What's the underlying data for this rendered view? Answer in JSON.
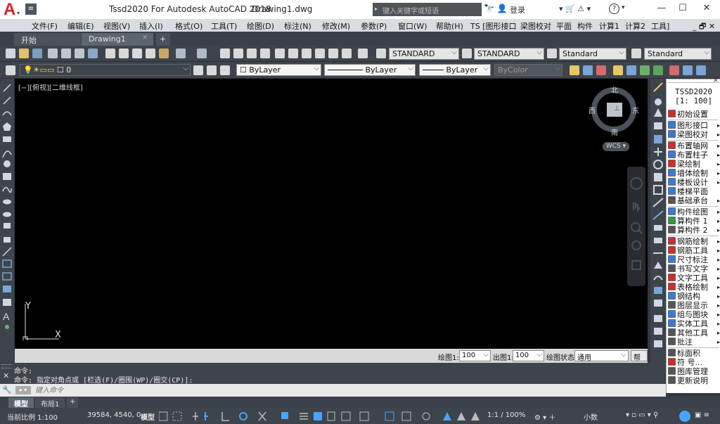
{
  "title_bar": {
    "app_title": "Tssd2020 For Autodesk AutoCAD 2018",
    "doc_title": "Drawing1.dwg",
    "search_placeholder": "键入关键字或短语",
    "login_label": "登录",
    "minimize": "—",
    "maximize": "☐",
    "close": "✕"
  },
  "menus": [
    "文件(F)",
    "编辑(E)",
    "视图(V)",
    "插入(I)",
    "格式(O)",
    "工具(T)",
    "绘图(D)",
    "标注(N)",
    "修改(M)",
    "参数(P)",
    "窗口(W)",
    "帮助(H)",
    "TS [图形接口",
    "梁图校对",
    "平面",
    "构件",
    "计算1",
    "计算2",
    "工具]"
  ],
  "menubar_controls": "_ 🗗 ✕",
  "tabs": {
    "start": "开始",
    "drawing": "Drawing1",
    "close_symbol": "✕",
    "add_symbol": "+"
  },
  "toolbar1": {
    "text_style": "STANDARD",
    "dim_style": "STANDARD",
    "table_style": "Standard",
    "mleader_style": "Standard"
  },
  "toolbar2": {
    "layer": "0",
    "color": "ByLayer",
    "linetype": "ByLayer",
    "lineweight": "ByLayer",
    "plotstyle": "ByColor"
  },
  "canvas": {
    "viewport_label": "[−][俯视][二维线框]",
    "compass": {
      "n": "北",
      "s": "南",
      "e": "东",
      "w": "西"
    },
    "wcs_label": "WCS",
    "ucs": {
      "x": "X",
      "y": "Y"
    }
  },
  "prop_strip": {
    "plot_scale_label": "绘图1:",
    "plot_scale_value": "100",
    "out_scale_label": "出图1:",
    "out_scale_value": "100",
    "plot_status_label": "绘图状态",
    "plot_status_value": "通用",
    "help_label": "帮助"
  },
  "tssd_panel": {
    "title_line1": "TSSD2020",
    "title_line2": "[1: 100]",
    "items": [
      {
        "label": "初始设置",
        "arrow": "",
        "color": "#d42a2a"
      },
      {
        "label": "图形接口",
        "arrow": "▸",
        "color": "#3a7bd5"
      },
      {
        "label": "梁图校对",
        "arrow": "▸",
        "color": "#3a7bd5"
      },
      {
        "label": "布置轴网",
        "arrow": "▸",
        "color": "#d42a2a"
      },
      {
        "label": "布置柱子",
        "arrow": "▸",
        "color": "#3a7bd5"
      },
      {
        "label": "梁绘制",
        "arrow": "▸",
        "color": "#d42a2a"
      },
      {
        "label": "墙体绘制",
        "arrow": "▸",
        "color": "#3a7bd5"
      },
      {
        "label": "楼板设计",
        "arrow": "▸",
        "color": "#3a7bd5"
      },
      {
        "label": "楼梯平面",
        "arrow": "",
        "color": "#3a7bd5"
      },
      {
        "label": "基础承台",
        "arrow": "▸",
        "color": "#555555"
      },
      {
        "label": "构件绘图",
        "arrow": "▸",
        "color": "#3a7bd5"
      },
      {
        "label": "算构件 1",
        "arrow": "▸",
        "color": "#2e9e3e"
      },
      {
        "label": "算构件 2",
        "arrow": "▸",
        "color": "#555555"
      },
      {
        "label": "钢筋绘制",
        "arrow": "▸",
        "color": "#d42a2a"
      },
      {
        "label": "钢筋工具",
        "arrow": "▸",
        "color": "#d42a2a"
      },
      {
        "label": "尺寸标注",
        "arrow": "▸",
        "color": "#3a7bd5"
      },
      {
        "label": "书写文字",
        "arrow": "▸",
        "color": "#555555"
      },
      {
        "label": "文字工具",
        "arrow": "▸",
        "color": "#d42a2a"
      },
      {
        "label": "表格绘制",
        "arrow": "▸",
        "color": "#d42a2a"
      },
      {
        "label": "钢结构",
        "arrow": "▸",
        "color": "#3a7bd5"
      },
      {
        "label": "图层显示",
        "arrow": "▸",
        "color": "#555555"
      },
      {
        "label": "组与图块",
        "arrow": "▸",
        "color": "#3a7bd5"
      },
      {
        "label": "实体工具",
        "arrow": "▸",
        "color": "#3a7bd5"
      },
      {
        "label": "其他工具",
        "arrow": "▸",
        "color": "#555555"
      },
      {
        "label": "批注",
        "arrow": "▸",
        "color": "#555555"
      },
      {
        "label": "标面积",
        "arrow": "",
        "color": "#555555"
      },
      {
        "label": "符 号...",
        "arrow": "",
        "color": "#d42a2a"
      },
      {
        "label": "图库管理",
        "arrow": "",
        "color": "#555555"
      },
      {
        "label": "更新说明",
        "arrow": "",
        "color": "#555555"
      }
    ]
  },
  "command": {
    "line1": "命令:",
    "line2": "命令: 指定对角点或 [栏选(F)/圈围(WP)/圈交(CP)]:",
    "placeholder": "键入命令"
  },
  "layout_tabs": [
    "模型",
    "布局1"
  ],
  "layout_add": "+",
  "status": {
    "scale": "当前比例 1:100",
    "coords": "39584, 4540, 0",
    "model": "模型",
    "annot_scale": "1:1 / 100%",
    "units": "小数"
  },
  "colors": {
    "accent_red": "#d8232a",
    "canvas_bg": "#000000",
    "ui_dark": "#3e444c"
  }
}
